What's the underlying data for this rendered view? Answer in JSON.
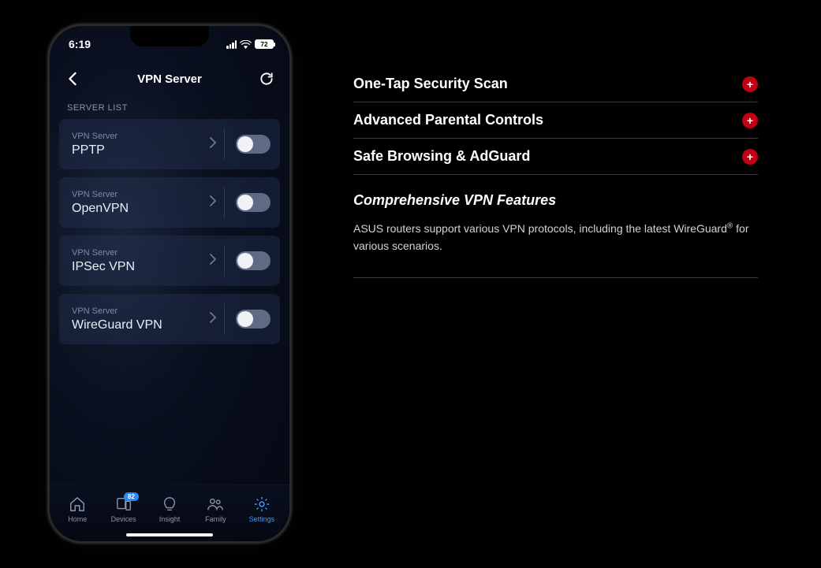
{
  "phone": {
    "status": {
      "time": "6:19",
      "battery": "72"
    },
    "header": {
      "title": "VPN Server"
    },
    "section_label": "SERVER LIST",
    "card_sub_label": "VPN Server",
    "servers": [
      {
        "name": "PPTP"
      },
      {
        "name": "OpenVPN"
      },
      {
        "name": "IPSec VPN"
      },
      {
        "name": "WireGuard VPN"
      }
    ],
    "tabs": {
      "home": "Home",
      "devices": "Devices",
      "devices_badge": "82",
      "insight": "Insight",
      "family": "Family",
      "settings": "Settings"
    }
  },
  "accordion": [
    {
      "title": "One-Tap Security Scan"
    },
    {
      "title": "Advanced Parental Controls"
    },
    {
      "title": "Safe Browsing & AdGuard"
    }
  ],
  "expanded": {
    "title": "Comprehensive VPN Features",
    "body_pre": "ASUS routers support various VPN protocols, including the latest WireGuard",
    "body_sup": "®",
    "body_post": " for various scenarios."
  }
}
